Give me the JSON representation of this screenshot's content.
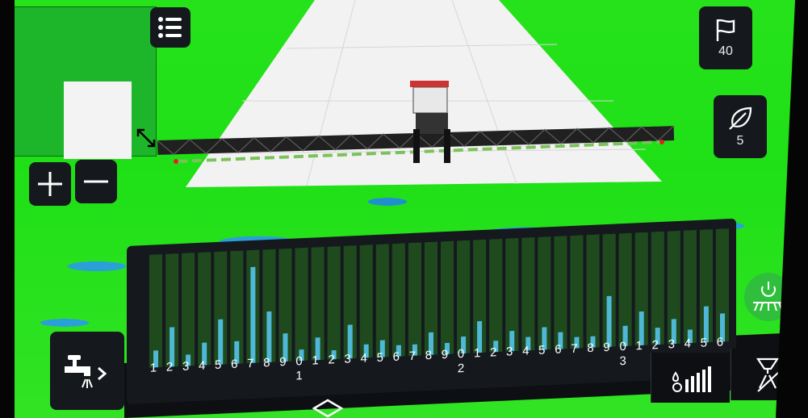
{
  "map_controls": {
    "menu_icon": "list-icon",
    "zoom_in_icon": "plus-icon",
    "zoom_out_icon": "minus-icon",
    "resize_icon": "diagonal-resize-icon"
  },
  "side_buttons": [
    {
      "icon": "flag-icon",
      "count": "40"
    },
    {
      "icon": "leaf-icon",
      "count": "5"
    }
  ],
  "boom_sections": {
    "tick_labels": [
      "1",
      "2",
      "3",
      "4",
      "5",
      "6",
      "7",
      "8",
      "9",
      "0",
      "1",
      "2",
      "3",
      "4",
      "5",
      "6",
      "7",
      "8",
      "9",
      "0",
      "1",
      "2",
      "3",
      "4",
      "5",
      "6",
      "7",
      "8",
      "9",
      "0",
      "1",
      "2",
      "3",
      "4",
      "5",
      "6"
    ],
    "group_labels": [
      {
        "after_index": 9,
        "text": "1"
      },
      {
        "after_index": 19,
        "text": "2"
      },
      {
        "after_index": 29,
        "text": "3"
      }
    ],
    "levels": [
      0.15,
      0.35,
      0.1,
      0.2,
      0.4,
      0.2,
      0.85,
      0.45,
      0.25,
      0.1,
      0.2,
      0.08,
      0.3,
      0.12,
      0.15,
      0.1,
      0.1,
      0.2,
      0.1,
      0.15,
      0.28,
      0.1,
      0.18,
      0.12,
      0.2,
      0.15,
      0.1,
      0.1,
      0.45,
      0.18,
      0.3,
      0.15,
      0.22,
      0.12,
      0.32,
      0.25
    ]
  },
  "bottom_toolbar": {
    "faucet_icon": "faucet-spray-icon",
    "rate_icon": "droplet-bars-icon",
    "nozzle_icon": "nozzle-off-icon",
    "power_icon": "power-boom-icon",
    "home_icon": "home-chevron-icon"
  },
  "colors": {
    "field_green": "#26e21b",
    "water_blue": "#2aa0d8",
    "panel_dark": "#15191e",
    "bar_fill": "#4fb8d6",
    "power_green": "#2fbf3d"
  }
}
